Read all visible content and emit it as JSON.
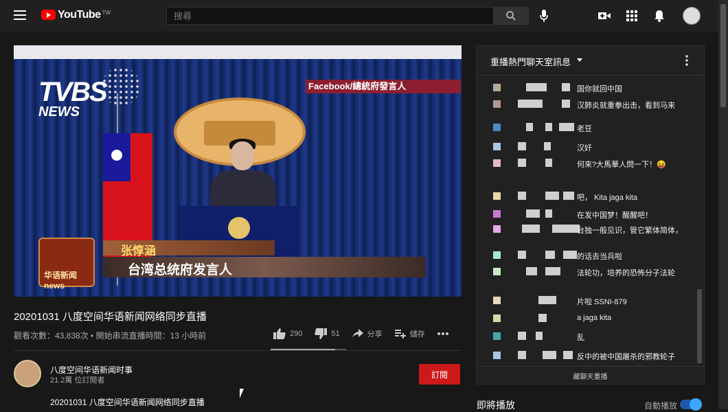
{
  "header": {
    "logo_text": "YouTube",
    "region": "TW",
    "search_placeholder": "搜尋"
  },
  "video": {
    "overlay_source": "Facebook/總統府發言人",
    "lower_third_name": "张惇涵",
    "lower_third_title": "台湾总统府发言人",
    "news_logo_text": "华语新闻 news",
    "tvbs_logo_big": "TVBS",
    "tvbs_logo_small": "NEWS"
  },
  "info": {
    "title": "20201031 八度空间华语新闻网络同步直播",
    "views": "觀看次數：43,838次 • 開始串流直播時間：13 小時前",
    "like_count": "290",
    "dislike_count": "51",
    "share_label": "分享",
    "save_label": "儲存",
    "like_ratio": 0.85
  },
  "channel": {
    "name": "八度空间华语新闻时事",
    "subscribers": "21.2萬 位訂閱者",
    "subscribe_label": "訂閱",
    "description": "20201031 八度空间华语新闻网络同步直播"
  },
  "chat": {
    "title": "重播熱門聊天室訊息",
    "footer_label": "藏聊天重播",
    "messages": [
      {
        "text": "国你就回中国",
        "avatar_color": "#b8a89a"
      },
      {
        "text": "汉肺炎就重拳出击，看到马来",
        "avatar_color": "#b49a90"
      },
      {
        "text": "老豆",
        "avatar_color": "#4a8ac8"
      },
      {
        "text": "汉奸",
        "avatar_color": "#a8c8e8"
      },
      {
        "text": "何來?大馬華人問一下！😝",
        "avatar_color": "#e8b8d0"
      },
      {
        "text": "吧， Kita jaga kita",
        "avatar_color": "#e8d8a8"
      },
      {
        "text": "在发中国梦！醒醒吧！",
        "avatar_color": "#c878d0"
      },
      {
        "text": "台独一般见识，管它繁体简体，",
        "avatar_color": "#e8a8e8"
      },
      {
        "text": "的话去当兵啦",
        "avatar_color": "#a8e8d8"
      },
      {
        "text": "法轮功，培养的恐怖分子法轮",
        "avatar_color": "#c8e8c8"
      },
      {
        "text": "片啦 SSNI-879",
        "avatar_color": "#e8d8b8"
      },
      {
        "text": "a jaga kita",
        "avatar_color": "#d8d8a8"
      },
      {
        "text": "乱",
        "avatar_color": "#48a8a8"
      },
      {
        "text": "反中的被中国屠杀的邪教轮子",
        "avatar_color": "#a8c8e8"
      }
    ]
  },
  "sidebar": {
    "up_next_label": "即將播放",
    "autoplay_label": "自動播放",
    "autoplay_on": true
  }
}
